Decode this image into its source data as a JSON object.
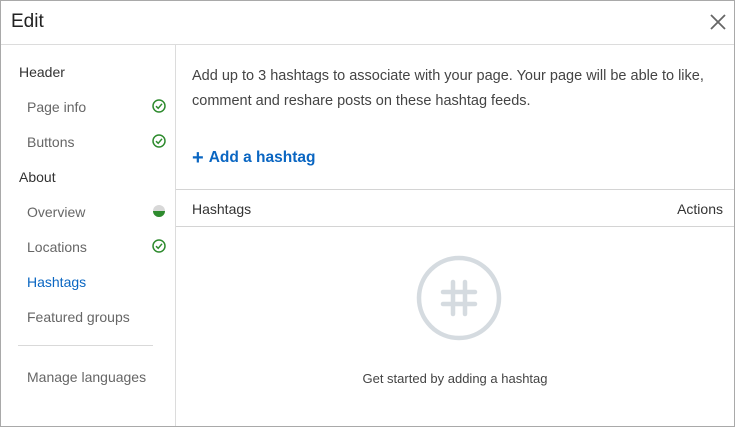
{
  "dialog": {
    "title": "Edit",
    "close_icon": "close-icon"
  },
  "sidebar": {
    "sections": [
      {
        "label": "Header"
      },
      {
        "label": "About"
      }
    ],
    "items": [
      {
        "label": "Page info",
        "status": "complete"
      },
      {
        "label": "Buttons",
        "status": "complete"
      },
      {
        "label": "Overview",
        "status": "partial"
      },
      {
        "label": "Locations",
        "status": "complete"
      },
      {
        "label": "Hashtags",
        "status": "active"
      },
      {
        "label": "Featured groups",
        "status": "none"
      }
    ],
    "manage_languages": "Manage languages"
  },
  "main": {
    "description": "Add up to 3 hashtags to associate with your page. Your page will be able to like, comment and reshare posts on these hashtag feeds.",
    "add_hashtag": "Add a hashtag",
    "add_icon": "plus-icon",
    "table": {
      "col_hashtags": "Hashtags",
      "col_actions": "Actions"
    },
    "empty": {
      "icon": "hashtag-icon",
      "text": "Get started by adding a hashtag"
    }
  },
  "colors": {
    "accent": "#0a66c2",
    "success": "#2e8b2e",
    "border": "#dcdcdc"
  }
}
